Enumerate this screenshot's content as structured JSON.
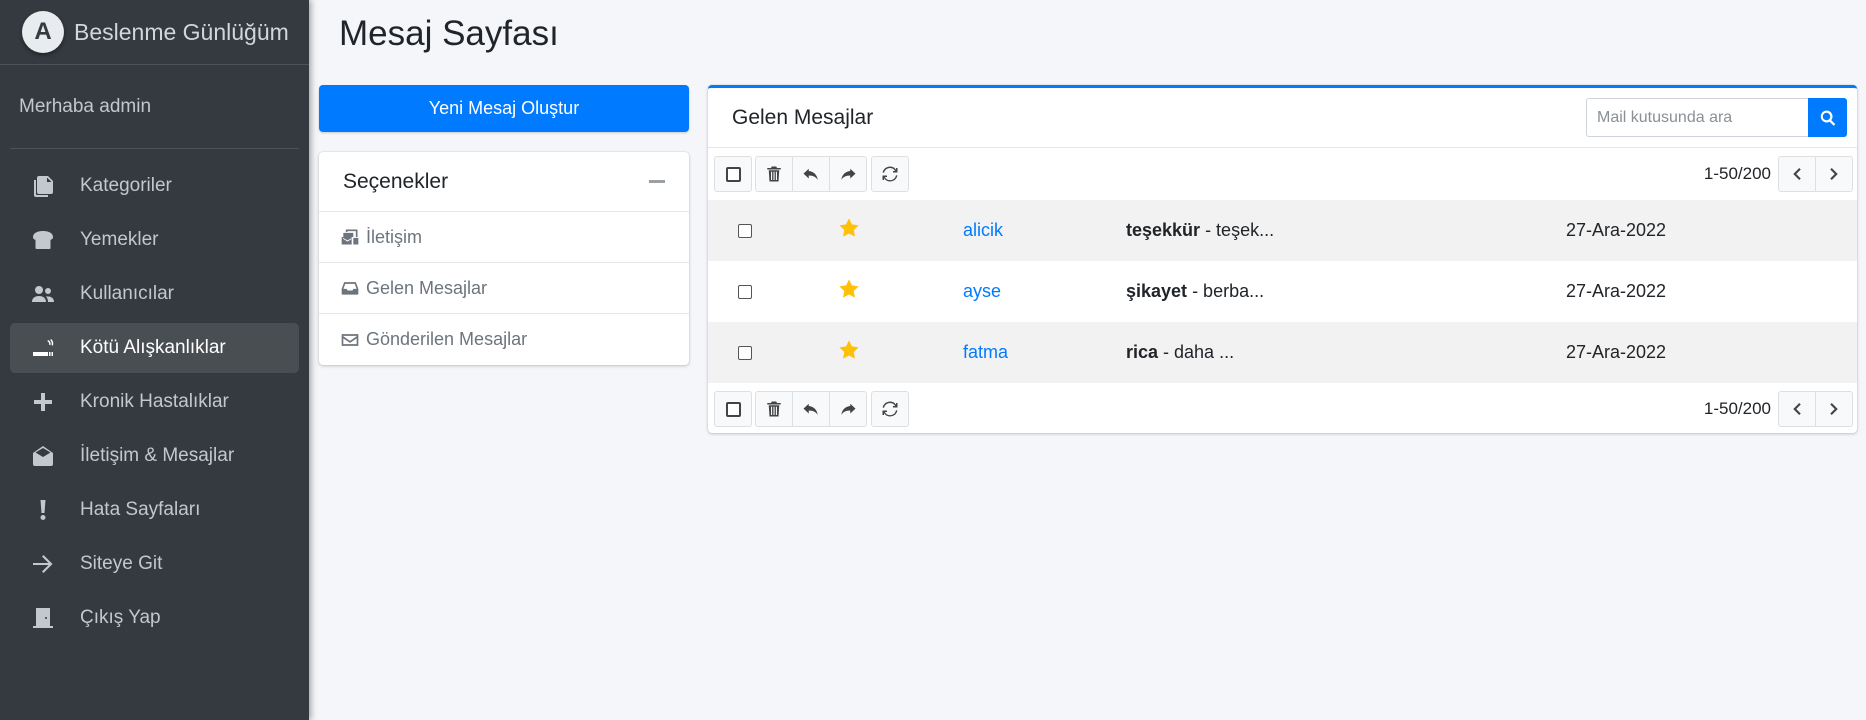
{
  "brand": {
    "logo_letter": "A",
    "name": "Beslenme Günlüğüm"
  },
  "user": {
    "greeting": "Merhaba admin"
  },
  "sidebar": {
    "items": [
      {
        "label": "Kategoriler",
        "icon": "copy-icon",
        "active": false
      },
      {
        "label": "Yemekler",
        "icon": "bread-icon",
        "active": false
      },
      {
        "label": "Kullanıcılar",
        "icon": "users-icon",
        "active": false
      },
      {
        "label": "Kötü Alışkanlıklar",
        "icon": "smoking-icon",
        "active": true
      },
      {
        "label": "Kronik Hastalıklar",
        "icon": "plus-icon",
        "active": false
      },
      {
        "label": "İletişim & Mesajlar",
        "icon": "envelope-open-icon",
        "active": false
      },
      {
        "label": "Hata Sayfaları",
        "icon": "exclamation-icon",
        "active": false
      },
      {
        "label": "Siteye Git",
        "icon": "arrow-right-icon",
        "active": false
      },
      {
        "label": "Çıkış Yap",
        "icon": "door-icon",
        "active": false
      }
    ]
  },
  "page": {
    "title": "Mesaj Sayfası"
  },
  "compose": {
    "label": "Yeni Mesaj Oluştur"
  },
  "options": {
    "title": "Seçenekler",
    "items": [
      {
        "label": "İletişim",
        "icon": "mail-bulk-icon"
      },
      {
        "label": "Gelen Mesajlar",
        "icon": "inbox-icon"
      },
      {
        "label": "Gönderilen Mesajlar",
        "icon": "envelope-icon"
      }
    ]
  },
  "inbox": {
    "title": "Gelen Mesajlar",
    "search_placeholder": "Mail kutusunda ara",
    "pager": "1-50/200",
    "messages": [
      {
        "sender": "alicik",
        "subject": "teşekkür",
        "preview": " - teşek...",
        "date": "27-Ara-2022",
        "starred": true
      },
      {
        "sender": "ayse",
        "subject": "şikayet",
        "preview": " - berba...",
        "date": "27-Ara-2022",
        "starred": true
      },
      {
        "sender": "fatma",
        "subject": "rica",
        "preview": " - daha ...",
        "date": "27-Ara-2022",
        "starred": true
      }
    ]
  },
  "colors": {
    "sidebar_bg": "#343a40",
    "primary": "#007bff",
    "star": "#ffc107",
    "page_bg": "#f4f6f9"
  }
}
